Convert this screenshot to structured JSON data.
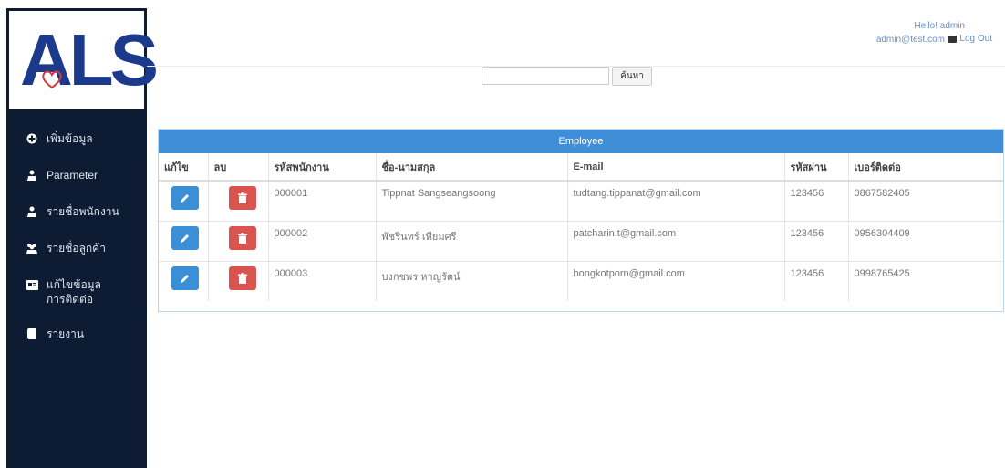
{
  "brand": {
    "logo_text": "ALS"
  },
  "sidebar": {
    "items": [
      {
        "label": "เพิ่มข้อมูล",
        "icon": "plus-circle-icon"
      },
      {
        "label": "Parameter",
        "icon": "user-icon"
      },
      {
        "label": "รายชื่อพนักงาน",
        "icon": "user-icon"
      },
      {
        "label": "รายชื่อลูกค้า",
        "icon": "users-icon"
      },
      {
        "label": "แก้ไขข้อมูลการติดต่อ",
        "icon": "id-card-icon"
      },
      {
        "label": "รายงาน",
        "icon": "book-icon"
      }
    ]
  },
  "header": {
    "user_name": "Hello! admin",
    "user_email": "admin@test.com",
    "logout_label": "Log Out"
  },
  "search": {
    "value": "",
    "button_label": "ค้นหา"
  },
  "panel": {
    "title": "Employee",
    "columns": [
      "แก้ไข",
      "ลบ",
      "รหัสพนักงาน",
      "ชื่อ-นามสกุล",
      "E-mail",
      "รหัสผ่าน",
      "เบอร์ติดต่อ"
    ],
    "rows": [
      {
        "id": "000001",
        "name": "Tippnat Sangseangsoong",
        "email": "tudtang.tippanat@gmail.com",
        "password": "123456",
        "phone": "0867582405"
      },
      {
        "id": "000002",
        "name": "พัชรินทร์ เทียมศรี",
        "email": "patcharin.t@gmail.com",
        "password": "123456",
        "phone": "0956304409"
      },
      {
        "id": "000003",
        "name": "บงกชพร หาญรัตน์",
        "email": "bongkotporn@gmail.com",
        "password": "123456",
        "phone": "0998765425"
      }
    ]
  },
  "colors": {
    "sidebar_bg": "#0d1b33",
    "panel_heading": "#3e8fd8",
    "edit_button": "#3a8fd6",
    "delete_button": "#d9534f"
  }
}
